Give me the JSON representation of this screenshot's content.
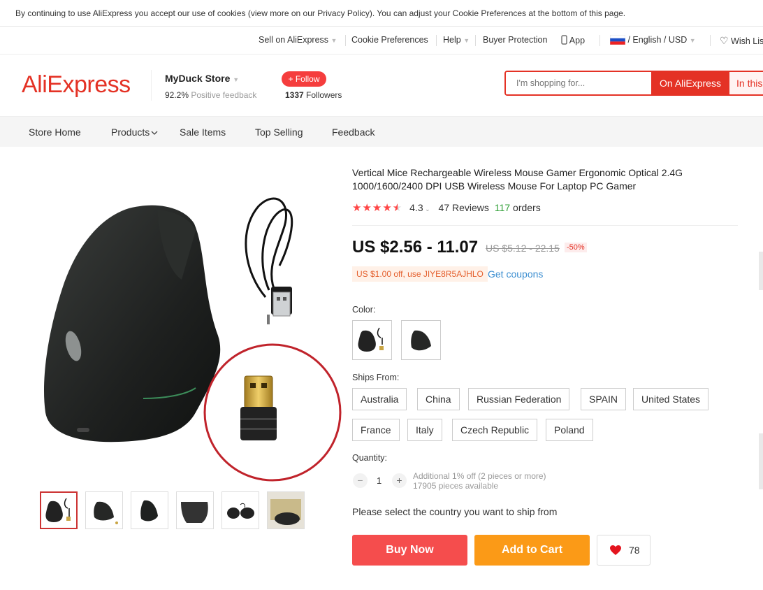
{
  "cookie_bar": {
    "text": "By continuing to use AliExpress you accept our use of cookies (view more on our Privacy Policy). You can adjust your Cookie Preferences at the bottom of this page."
  },
  "topnav": {
    "sell": "Sell on AliExpress",
    "cookie": "Cookie Preferences",
    "help": "Help",
    "buyer_protection": "Buyer Protection",
    "app": "App",
    "language": "/ English /",
    "currency": "USD",
    "wishlist": "Wish Lis"
  },
  "header": {
    "logo": "AliExpress",
    "store_name": "MyDuck Store",
    "feedback_pct": "92.2%",
    "feedback_label": "Positive feedback",
    "follow": "+ Follow",
    "followers_count": "1337",
    "followers_label": "Followers",
    "search_placeholder": "I'm shopping for...",
    "search_on_ali": "On AliExpress",
    "search_in_store": "In this"
  },
  "storenav": [
    "Store Home",
    "Products",
    "Sale Items",
    "Top Selling",
    "Feedback"
  ],
  "product": {
    "title": "Vertical Mice Rechargeable Wireless Mouse Gamer Ergonomic Optical 2.4G 1000/1600/2400 DPI USB Wireless Mouse For Laptop PC Gamer",
    "rating_value": "4.3",
    "rating_stars": 4.3,
    "reviews": "47 Reviews",
    "orders_count": "117",
    "orders_label": "orders",
    "price": "US $2.56 - 11.07",
    "old_price": "US $5.12 - 22.15",
    "discount": "-50%",
    "coupon": "US $1.00 off, use JIYE8R5AJHLO",
    "get_coupons": "Get coupons",
    "color_label": "Color:",
    "ships_from_label": "Ships From:",
    "ships_from": [
      "Australia",
      "China",
      "Russian Federation",
      "SPAIN",
      "United States",
      "France",
      "Italy",
      "Czech Republic",
      "Poland"
    ],
    "quantity_label": "Quantity:",
    "quantity": "1",
    "qty_minus": "−",
    "qty_plus": "+",
    "qty_additional": "Additional 1% off (2 pieces or more)",
    "qty_available": "17905 pieces available",
    "ship_msg": "Please select the country you want to ship from",
    "buy_now": "Buy Now",
    "add_to_cart": "Add to Cart",
    "wish_count": "78"
  },
  "colors": {
    "brand": "#e43225",
    "buy": "#f54d4d",
    "cart": "#fb9a17",
    "link": "#3d8fd1"
  }
}
